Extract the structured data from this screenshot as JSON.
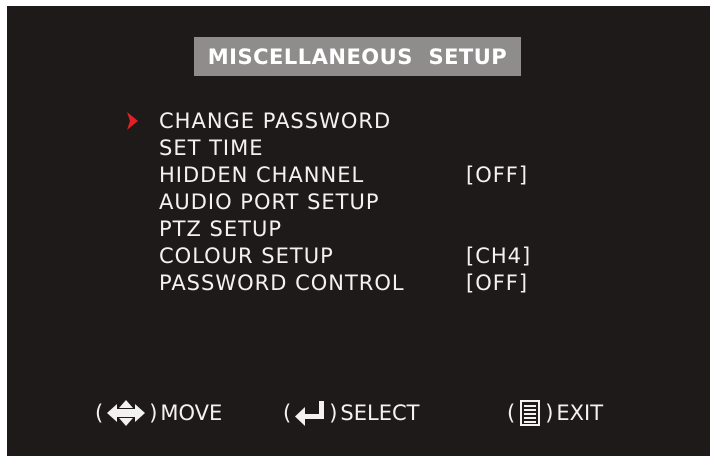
{
  "title": "MISCELLANEOUS  SETUP",
  "menu": {
    "items": [
      {
        "label": "CHANGE PASSWORD",
        "value": "",
        "selected": true
      },
      {
        "label": "SET TIME",
        "value": ""
      },
      {
        "label": "HIDDEN CHANNEL",
        "value": "[OFF]"
      },
      {
        "label": "AUDIO PORT SETUP",
        "value": ""
      },
      {
        "label": "PTZ SETUP",
        "value": ""
      },
      {
        "label": "COLOUR SETUP",
        "value": "[CH4]"
      },
      {
        "label": "PASSWORD CONTROL",
        "value": "[OFF]"
      }
    ],
    "selector_icon": "chevron-right-icon",
    "selector_color": "#e31e24"
  },
  "footer": {
    "move": {
      "icon": "four-way-arrows-icon",
      "label": "MOVE"
    },
    "select": {
      "icon": "enter-key-icon",
      "label": "SELECT"
    },
    "exit": {
      "icon": "menu-list-icon",
      "label": "EXIT"
    }
  },
  "colors": {
    "background": "#1d1a19",
    "title_bar": "#8e8d8c",
    "text": "#f4f2f0"
  }
}
